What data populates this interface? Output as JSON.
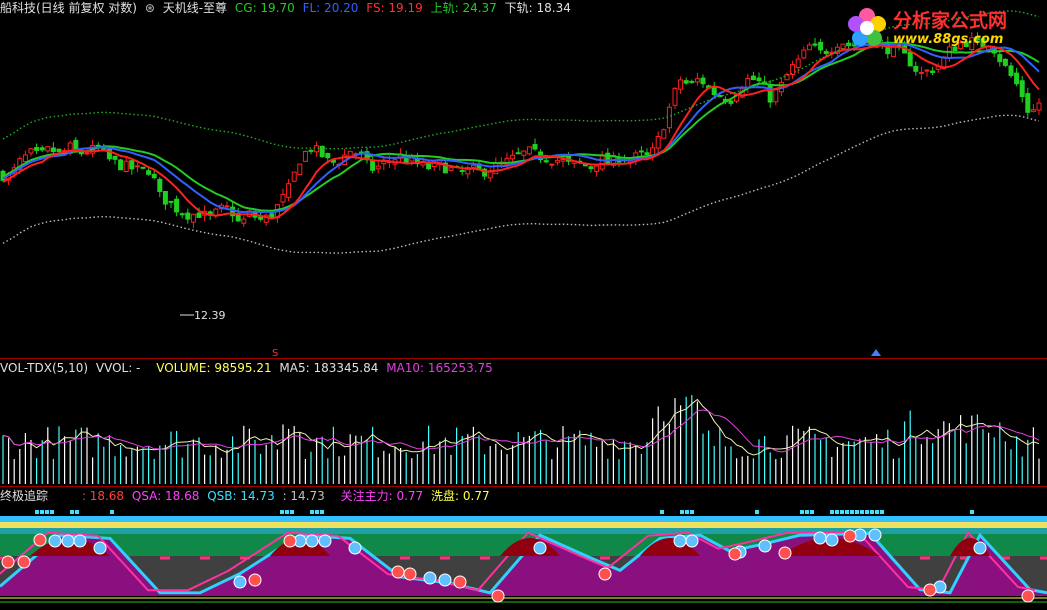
{
  "main_header": {
    "stock": "船科技(日线 前复权 对数)",
    "indicator": "天机线-至尊",
    "cg_label": "CG: 19.70",
    "fl_label": "FL: 20.20",
    "fs_label": "FS: 19.19",
    "upper_label": "上轨: 24.37",
    "lower_label": "下轨: 18.34"
  },
  "vol_header": {
    "name": "VOL-TDX(5,10)",
    "vvol": "VVOL: -",
    "volume": "VOLUME: 98595.21",
    "ma5": "MA5: 183345.84",
    "ma10": "MA10: 165253.75"
  },
  "ind_header": {
    "name": "终极追踪",
    "v1": ": 18.68",
    "qsa": "QSA: 18.68",
    "qsb": "QSB: 14.73",
    "v2": ": 14.73",
    "focus": "关注主力: 0.77",
    "wash": "洗盘: 0.77"
  },
  "logo": {
    "title": "分析家公式网",
    "url": "www.88gs.com"
  },
  "chart_data": {
    "type": "candlestick",
    "low_annotation": "12.39",
    "markers": [
      "S"
    ],
    "close_points": [
      [
        0,
        20.6
      ],
      [
        10,
        20.4
      ],
      [
        20,
        21.4
      ],
      [
        30,
        22.0
      ],
      [
        40,
        21.8
      ],
      [
        50,
        22.3
      ],
      [
        60,
        21.9
      ],
      [
        70,
        22.4
      ],
      [
        80,
        22.0
      ],
      [
        90,
        22.2
      ],
      [
        100,
        22.3
      ],
      [
        110,
        21.5
      ],
      [
        120,
        21.2
      ],
      [
        130,
        21.0
      ],
      [
        140,
        20.8
      ],
      [
        150,
        20.9
      ],
      [
        160,
        19.2
      ],
      [
        170,
        18.8
      ],
      [
        180,
        18.3
      ],
      [
        190,
        18.1
      ],
      [
        200,
        18.2
      ],
      [
        210,
        17.9
      ],
      [
        220,
        18.4
      ],
      [
        230,
        18.5
      ],
      [
        240,
        17.5
      ],
      [
        250,
        18.2
      ],
      [
        260,
        17.8
      ],
      [
        270,
        18.0
      ],
      [
        280,
        18.8
      ],
      [
        290,
        19.8
      ],
      [
        300,
        21.6
      ],
      [
        310,
        22.4
      ],
      [
        320,
        22.0
      ],
      [
        330,
        21.3
      ],
      [
        340,
        21.5
      ],
      [
        350,
        22.2
      ],
      [
        360,
        21.9
      ],
      [
        370,
        20.9
      ],
      [
        380,
        21.1
      ],
      [
        390,
        21.5
      ],
      [
        400,
        21.8
      ],
      [
        410,
        21.4
      ],
      [
        420,
        21.2
      ],
      [
        430,
        21.0
      ],
      [
        440,
        21.2
      ],
      [
        450,
        20.9
      ],
      [
        460,
        20.6
      ],
      [
        470,
        20.9
      ],
      [
        480,
        20.7
      ],
      [
        490,
        20.9
      ],
      [
        500,
        21.2
      ],
      [
        510,
        21.5
      ],
      [
        520,
        21.9
      ],
      [
        530,
        22.1
      ],
      [
        540,
        21.8
      ],
      [
        550,
        21.6
      ],
      [
        560,
        21.5
      ],
      [
        570,
        21.2
      ],
      [
        580,
        21.3
      ],
      [
        590,
        21.0
      ],
      [
        600,
        21.6
      ],
      [
        610,
        21.3
      ],
      [
        620,
        21.8
      ],
      [
        630,
        21.5
      ],
      [
        640,
        21.9
      ],
      [
        650,
        21.7
      ],
      [
        660,
        23.2
      ],
      [
        670,
        25.5
      ],
      [
        680,
        27.8
      ],
      [
        690,
        27.2
      ],
      [
        700,
        27.9
      ],
      [
        710,
        26.8
      ],
      [
        720,
        26.4
      ],
      [
        730,
        26.0
      ],
      [
        740,
        27.2
      ],
      [
        750,
        27.9
      ],
      [
        760,
        27.5
      ],
      [
        770,
        26.2
      ],
      [
        780,
        27.0
      ],
      [
        790,
        28.6
      ],
      [
        800,
        29.6
      ],
      [
        810,
        30.9
      ],
      [
        820,
        30.2
      ],
      [
        830,
        30.6
      ],
      [
        840,
        31.4
      ],
      [
        850,
        30.9
      ],
      [
        860,
        31.2
      ],
      [
        870,
        31.5
      ],
      [
        880,
        30.8
      ],
      [
        890,
        30.6
      ],
      [
        900,
        30.2
      ],
      [
        910,
        29.4
      ],
      [
        920,
        28.2
      ],
      [
        930,
        28.6
      ],
      [
        940,
        29.1
      ],
      [
        950,
        30.5
      ],
      [
        960,
        31.1
      ],
      [
        970,
        31.4
      ],
      [
        980,
        30.9
      ],
      [
        990,
        31.3
      ],
      [
        1000,
        29.6
      ],
      [
        1010,
        28.2
      ],
      [
        1020,
        26.9
      ],
      [
        1030,
        24.8
      ],
      [
        1040,
        25.9
      ]
    ]
  }
}
